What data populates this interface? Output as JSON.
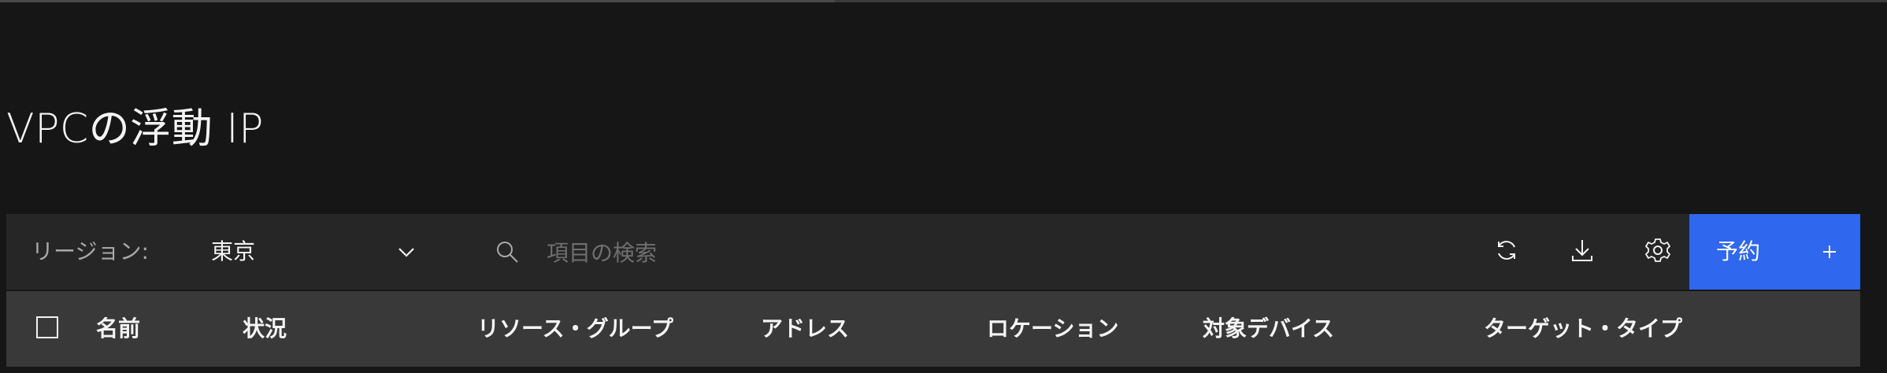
{
  "page": {
    "title": "VPCの浮動 IP"
  },
  "toolbar": {
    "region_label": "リージョン:",
    "region_value": "東京",
    "search_placeholder": "項目の検索",
    "reserve_label": "予約",
    "icons": [
      "refresh-icon",
      "download-icon",
      "settings-icon",
      "plus-icon"
    ]
  },
  "table": {
    "columns": [
      "名前",
      "状況",
      "リソース・グループ",
      "アドレス",
      "ロケーション",
      "対象デバイス",
      "ターゲット・タイプ"
    ]
  },
  "colors": {
    "background": "#161616",
    "toolbar": "#262626",
    "header": "#393939",
    "primary": "#2f67ef"
  }
}
